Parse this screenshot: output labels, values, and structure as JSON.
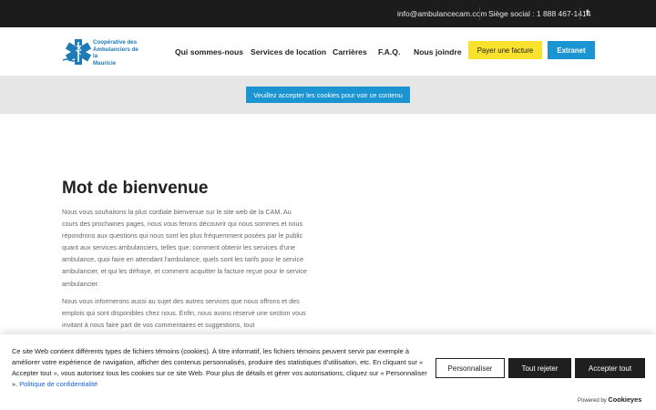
{
  "topbar": {
    "email": "info@ambulancecam.com",
    "phone": "Siège social : 1 888 467-1414",
    "social_icon": "facebook-icon",
    "social_glyph": "f"
  },
  "logo": {
    "lines": [
      "Coopérative des",
      "Ambulanciers de la",
      "Mauricie"
    ]
  },
  "nav": {
    "items": [
      "Qui sommes-nous",
      "Services de location",
      "Carrières",
      "F.A.Q.",
      "Nous joindre"
    ],
    "pay_button": "Payer une facture",
    "extranet_button": "Extranet"
  },
  "video_notice": {
    "button": "Veuillez accepter les cookies pour voir ce contenu"
  },
  "welcome": {
    "title": "Mot de bienvenue",
    "paragraph1": "Nous vous souhaitons la plus cordiale bienvenue sur le site web de la CAM. Au cours des prochaines pages, nous vous ferons découvrir qui nous sommes et nous répondrons aux questions qui nous sont les plus fréquemment posées par le public quant aux services ambulanciers, telles que: comment obtenir les services d'une ambulance, quoi faire en attendant l'ambulance, quels sont les tarifs pour le service ambulancier, et qui les défraye, et comment acquitter la facture reçue pour le service ambulancier.",
    "paragraph2": "Nous vous informerons aussi au sujet des autres services que nous offrons et des emplois qui sont disponibles chez nous. Enfin, nous avons réservé une section vous invitant à nous faire part de vos commentaires et suggestions, tout"
  },
  "consent": {
    "text": "Ce site Web contient différents types de fichiers témoins (cookies). À titre informatif, les fichiers témoins peuvent servir par exemple à améliorer votre expérience de navigation, afficher des contenus personnalisés, produire des statistiques d'utilisation, etc. En cliquant sur « Accepter tout », vous autorisez tous les cookies sur ce site Web. Pour plus de détails et gérer vos autorisations, cliquez sur « Personnaliser ».",
    "policy_link": "Politique de confidentialité",
    "customize": "Personnaliser",
    "reject": "Tout rejeter",
    "accept": "Accepter tout",
    "powered_by": "Powered by",
    "brand": "Cookieyes"
  },
  "colors": {
    "topbar_bg": "#1c1c1c",
    "accent_blue": "#1b94d2",
    "pay_yellow": "#f9e22e",
    "band_gray": "#e6e6e6",
    "consent_dark": "#1f1f1f"
  }
}
